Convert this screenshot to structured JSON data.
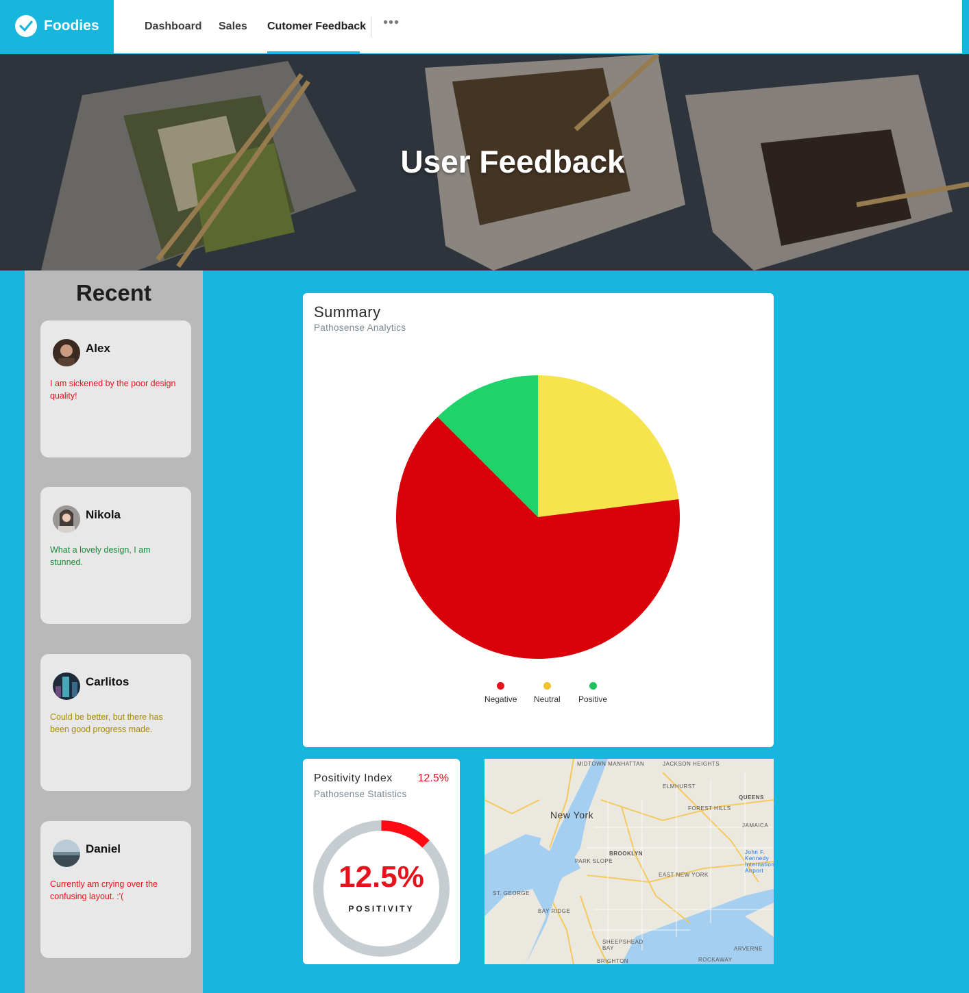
{
  "brand": {
    "name": "Foodies",
    "icon": "check-circle-icon",
    "color": "#17b6dc"
  },
  "nav": {
    "items": [
      {
        "label": "Dashboard"
      },
      {
        "label": "Sales"
      },
      {
        "label": "Cutomer Feedback",
        "active": true
      }
    ],
    "more_icon": "more-horizontal-icon"
  },
  "hero": {
    "title": "User Feedback"
  },
  "recent": {
    "title": "Recent",
    "cards": [
      {
        "name": "Alex",
        "text": "I am sickened by the poor design quality!",
        "color": "#e8121c"
      },
      {
        "name": "Nikola",
        "text": "What a lovely design, I am stunned.",
        "color": "#1a8a3a"
      },
      {
        "name": "Carlitos",
        "text": "Could be better, but there has been good progress made.",
        "color": "#a88a00"
      },
      {
        "name": "Daniel",
        "text": "Currently am crying over the confusing layout. :'(",
        "color": "#e8121c"
      }
    ]
  },
  "summary": {
    "title": "Summary",
    "subtitle": "Pathosense Analytics"
  },
  "chart_data": {
    "type": "pie",
    "categories": [
      "Negative",
      "Neutral",
      "Positive"
    ],
    "values": [
      64.5,
      23.0,
      12.5
    ],
    "colors": [
      "#d80009",
      "#f5e44c",
      "#1fd36a"
    ],
    "legend_colors": [
      "#e8121c",
      "#f2c12e",
      "#1fc25d"
    ],
    "legend": "bottom"
  },
  "positivity": {
    "title": "Positivity Index",
    "subtitle": "Pathosense Statistics",
    "value_text": "12.5%",
    "label": "POSITIVITY",
    "fraction": 0.125,
    "color": "#ff0a14",
    "track_color": "#c6cdd1"
  },
  "map": {
    "labels": [
      "MIDTOWN MANHATTAN",
      "JACKSON HEIGHTS",
      "ELMHURST",
      "QUEENS",
      "New York",
      "FOREST HILLS",
      "JAMAICA",
      "BROOKLYN",
      "PARK SLOPE",
      "EAST NEW YORK",
      "John F. Kennedy International Airport",
      "ST. GEORGE",
      "BAY RIDGE",
      "SHEEPSHEAD BAY",
      "ARVERNE",
      "BRIGHTON",
      "ROCKAWAY"
    ]
  }
}
